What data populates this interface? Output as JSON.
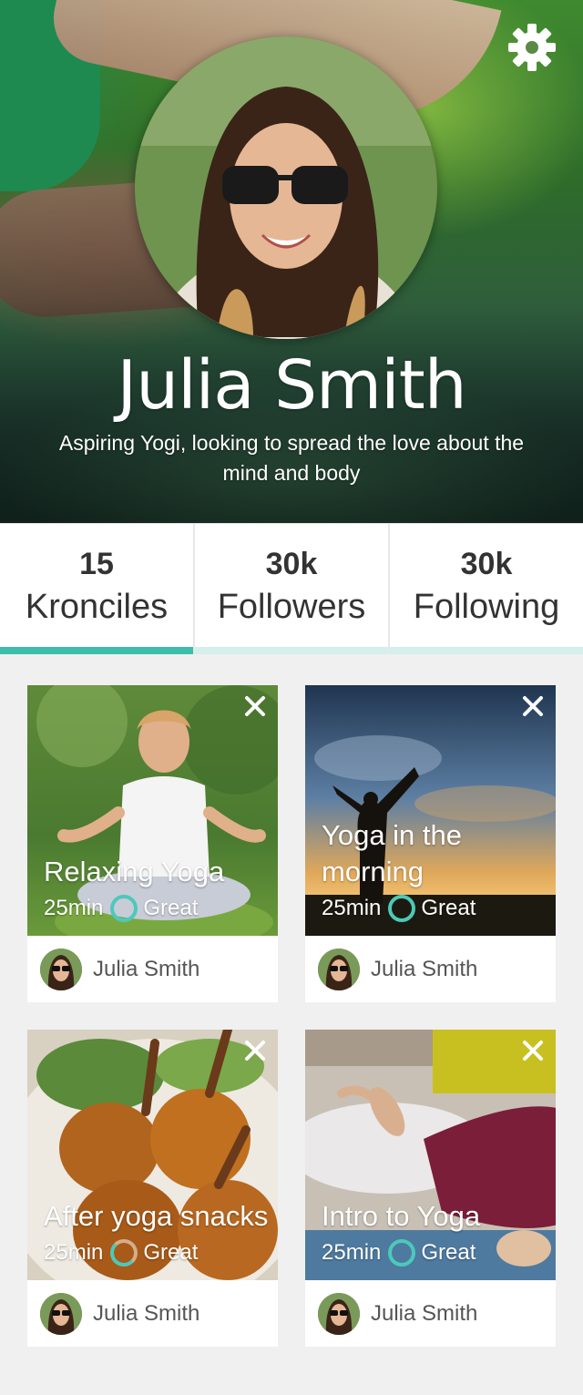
{
  "profile": {
    "name": "Julia Smith",
    "bio": "Aspiring Yogi, looking to spread the love about the mind and body"
  },
  "icons": {
    "settings": "gear-icon",
    "close": "close-icon",
    "rating": "ring-icon"
  },
  "colors": {
    "accent": "#3dbdac",
    "accent_light": "#d4efec"
  },
  "stats": [
    {
      "value": "15",
      "label": "Kronciles",
      "active": true
    },
    {
      "value": "30k",
      "label": "Followers",
      "active": false
    },
    {
      "value": "30k",
      "label": "Following",
      "active": false
    }
  ],
  "cards": [
    {
      "title": "Relaxing Yoga",
      "duration": "25min",
      "rating": "Great",
      "author": "Julia Smith"
    },
    {
      "title": "Yoga in the morning",
      "duration": "25min",
      "rating": "Great",
      "author": "Julia Smith"
    },
    {
      "title": "After yoga snacks",
      "duration": "25min",
      "rating": "Great",
      "author": "Julia Smith"
    },
    {
      "title": "Intro to Yoga",
      "duration": "25min",
      "rating": "Great",
      "author": "Julia Smith"
    }
  ]
}
